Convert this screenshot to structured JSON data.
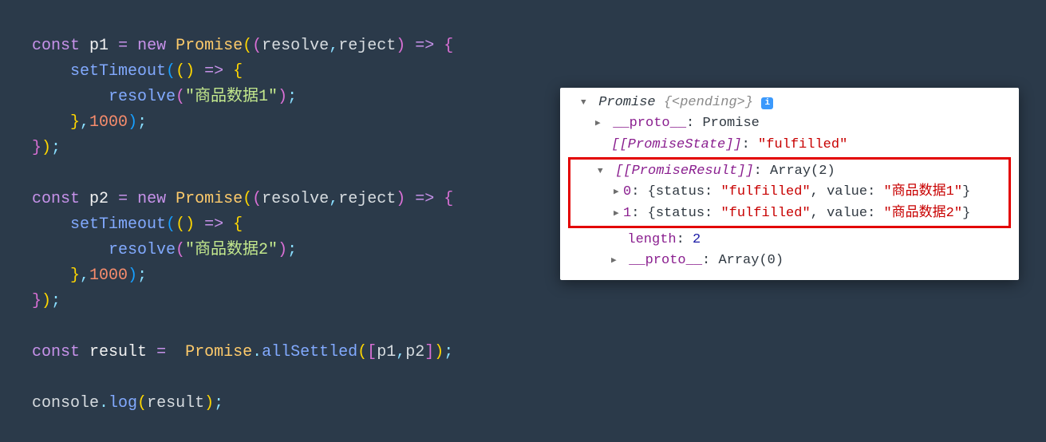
{
  "code": {
    "line1": {
      "const": "const",
      "p1": "p1",
      "eq": "=",
      "new": "new",
      "Promise": "Promise",
      "resolve": "resolve",
      "reject": "reject",
      "arrow": "=>"
    },
    "line2": {
      "setTimeout": "setTimeout",
      "arrow": "=>"
    },
    "line3": {
      "resolve": "resolve",
      "str": "\"商品数据1\""
    },
    "line4": {
      "num": "1000"
    },
    "line7": {
      "const": "const",
      "p2": "p2",
      "eq": "=",
      "new": "new",
      "Promise": "Promise",
      "resolve": "resolve",
      "reject": "reject",
      "arrow": "=>"
    },
    "line8": {
      "setTimeout": "setTimeout",
      "arrow": "=>"
    },
    "line9": {
      "resolve": "resolve",
      "str": "\"商品数据2\""
    },
    "line10": {
      "num": "1000"
    },
    "line13": {
      "const": "const",
      "result": "result",
      "eq": "=",
      "Promise": "Promise",
      "allSettled": "allSettled",
      "p1": "p1",
      "p2": "p2"
    },
    "line15": {
      "console": "console",
      "log": "log",
      "result": "result"
    }
  },
  "panel": {
    "header": {
      "promise": "Promise",
      "pending": "{<pending>}"
    },
    "proto": {
      "label": "__proto__",
      "value": "Promise"
    },
    "state": {
      "label": "[[PromiseState]]",
      "value": "\"fulfilled\""
    },
    "result": {
      "label": "[[PromiseResult]]",
      "value": "Array(2)"
    },
    "item0": {
      "idx": "0",
      "status_k": "status",
      "status_v": "\"fulfilled\"",
      "value_k": "value",
      "value_v": "\"商品数据1\""
    },
    "item1": {
      "idx": "1",
      "status_k": "status",
      "status_v": "\"fulfilled\"",
      "value_k": "value",
      "value_v": "\"商品数据2\""
    },
    "length": {
      "label": "length",
      "value": "2"
    },
    "proto2": {
      "label": "__proto__",
      "value": "Array(0)"
    }
  }
}
